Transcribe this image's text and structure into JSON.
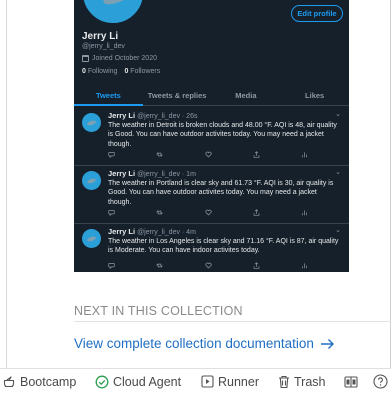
{
  "profile": {
    "name": "Jerry Li",
    "handle": "@jerry_li_dev",
    "joined": "Joined October 2020",
    "following_count": "0",
    "following_label": "Following",
    "followers_count": "0",
    "followers_label": "Followers",
    "edit_button": "Edit profile"
  },
  "tabs": [
    {
      "label": "Tweets"
    },
    {
      "label": "Tweets & replies"
    },
    {
      "label": "Media"
    },
    {
      "label": "Likes"
    }
  ],
  "tweets": [
    {
      "name": "Jerry Li",
      "meta": "@jerry_li_dev · 26s",
      "text": "The weather in Detroit is broken clouds and 48.00 °F. AQI is 48, air quality is Good. You can have outdoor activites today. You may need a jacket though."
    },
    {
      "name": "Jerry Li",
      "meta": "@jerry_li_dev · 1m",
      "text": "The weather in Portland is clear sky and 61.73 °F. AQI is 30, air quality is Good. You can have outdoor activites today. You may need a jacket though."
    },
    {
      "name": "Jerry Li",
      "meta": "@jerry_li_dev · 4m",
      "text": "The weather in Los Angeles is clear sky and 71.16 °F. AQI is 87, air quality is Moderate. You can have indoor activites today."
    }
  ],
  "doc": {
    "next_label": "NEXT IN THIS COLLECTION",
    "link_text": "View complete collection documentation"
  },
  "toolbar": {
    "bootcamp": "Bootcamp",
    "cloud_agent": "Cloud Agent",
    "runner": "Runner",
    "trash": "Trash"
  },
  "colors": {
    "twitter_bg": "#15202b",
    "twitter_accent": "#1d9bf0",
    "link_blue": "#1f6fc5",
    "agent_green": "#2e9e4f"
  }
}
